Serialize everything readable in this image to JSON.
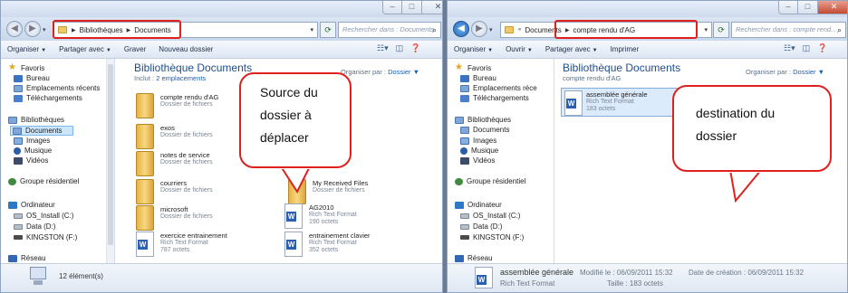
{
  "left": {
    "address": [
      "Bibliothèques",
      "Documents"
    ],
    "search_placeholder": "Rechercher dans : Documents",
    "toolbar": [
      "Organiser",
      "Partager avec",
      "Graver",
      "Nouveau dossier"
    ],
    "nav": {
      "favoris": "Favoris",
      "bureau": "Bureau",
      "emplacements": "Emplacements récents",
      "telechargements": "Téléchargements",
      "bibliotheques": "Bibliothèques",
      "documents": "Documents",
      "images": "Images",
      "musique": "Musique",
      "videos": "Vidéos",
      "groupe": "Groupe résidentiel",
      "ordinateur": "Ordinateur",
      "os": "OS_Install (C:)",
      "data": "Data (D:)",
      "kingston": "KINGSTON (F:)",
      "reseau": "Réseau"
    },
    "header": {
      "title": "Bibliothèque Documents",
      "inclut": "Inclut : ",
      "emplacements": "2 emplacements",
      "orga": "Organiser par :",
      "orga_value": "Dossier"
    },
    "items": {
      "compte": {
        "name": "compte rendu d'AG",
        "type": "Dossier de fichiers"
      },
      "exos": {
        "name": "exos",
        "type": "Dossier de fichiers"
      },
      "notes": {
        "name": "notes de service",
        "type": "Dossier de fichiers"
      },
      "courriers": {
        "name": "courriers",
        "type": "Dossier de fichiers"
      },
      "received": {
        "name": "My Received Files",
        "type": "Dossier de fichiers"
      },
      "microsoft": {
        "name": "microsoft",
        "type": "Dossier de fichiers"
      },
      "ag2010": {
        "name": "AG2010",
        "type": "Rich Text Format",
        "size": "190 octets"
      },
      "exercice": {
        "name": "exercice entrainement",
        "type": "Rich Text Format",
        "size": "787 octets"
      },
      "clavier": {
        "name": "entrainement clavier",
        "type": "Rich Text Format",
        "size": "352 octets"
      }
    },
    "status": "12 élément(s)",
    "bubble": [
      "Source du",
      "dossier à",
      "déplacer"
    ]
  },
  "right": {
    "address": [
      "Documents",
      "compte rendu d'AG"
    ],
    "search_placeholder": "Rechercher dans : compte rend...",
    "toolbar": [
      "Organiser",
      "Ouvrir",
      "Partager avec",
      "Imprimer"
    ],
    "nav": {
      "favoris": "Favoris",
      "bureau": "Bureau",
      "emplacements": "Emplacements réce",
      "telechargements": "Téléchargements",
      "bibliotheques": "Bibliothèques",
      "documents": "Documents",
      "images": "Images",
      "musique": "Musique",
      "videos": "Vidéos",
      "groupe": "Groupe résidentiel",
      "ordinateur": "Ordinateur",
      "os": "OS_Install (C:)",
      "data": "Data (D:)",
      "kingston": "KINGSTON (F:)",
      "reseau": "Réseau"
    },
    "header": {
      "title": "Bibliothèque Documents",
      "sub": "compte rendu d'AG",
      "orga": "Organiser par :",
      "orga_value": "Dossier"
    },
    "item": {
      "name": "assemblée générale",
      "type": "Rich Text Format",
      "size": "183 octets"
    },
    "status": {
      "name": "assemblée générale",
      "modified": "Modifié le : 06/09/2011 15:32",
      "created": "Date de création : 06/09/2011 15:32",
      "type": "Rich Text Format",
      "size": "Taille : 183 octets"
    },
    "bubble": [
      "destination du",
      "dossier"
    ]
  },
  "colors": {
    "highlight": "#e0201c",
    "link": "#1a5fb4",
    "title": "#1f4e8c"
  }
}
